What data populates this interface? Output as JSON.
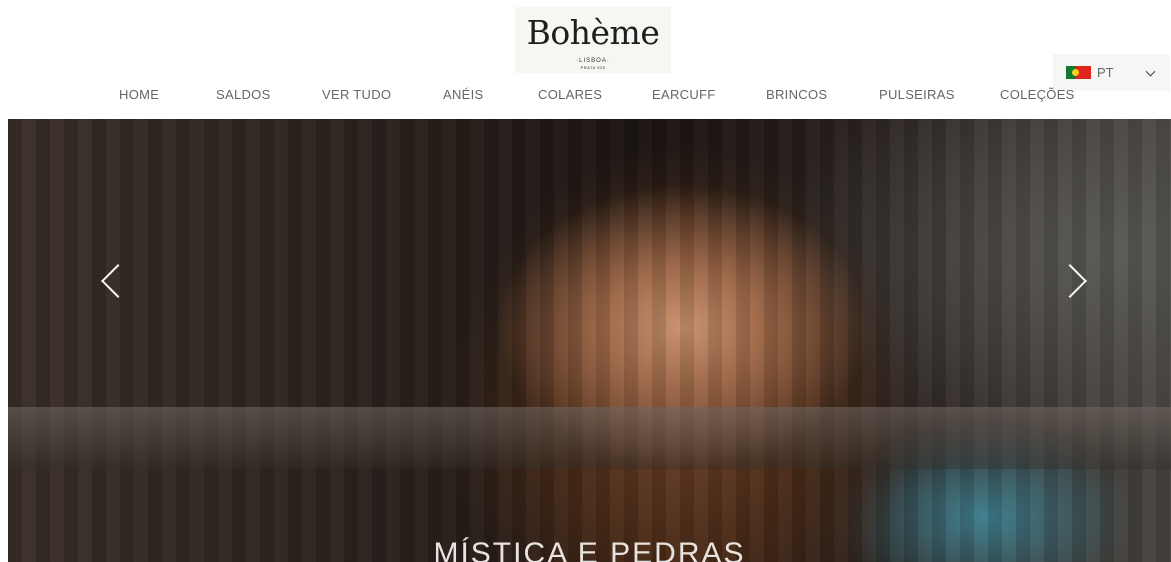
{
  "brand": {
    "name": "Bohème",
    "tagline": "·LISBOA·",
    "sub": "PRATA 925"
  },
  "language": {
    "code": "PT",
    "flag": "portugal-flag"
  },
  "nav": {
    "items": [
      {
        "label": "HOME"
      },
      {
        "label": "SALDOS"
      },
      {
        "label": "VER TUDO"
      },
      {
        "label": "ANÉIS"
      },
      {
        "label": "COLARES"
      },
      {
        "label": "EARCUFF"
      },
      {
        "label": "BRINCOS"
      },
      {
        "label": "PULSEIRAS"
      },
      {
        "label": "COLEÇÕES"
      }
    ]
  },
  "hero": {
    "caption": "MÍSTICA E PEDRAS",
    "image": "hero-model-photo"
  },
  "colors": {
    "background": "#ffffff",
    "nav_text": "#666666",
    "logo_bg": "#f7f6f3"
  }
}
